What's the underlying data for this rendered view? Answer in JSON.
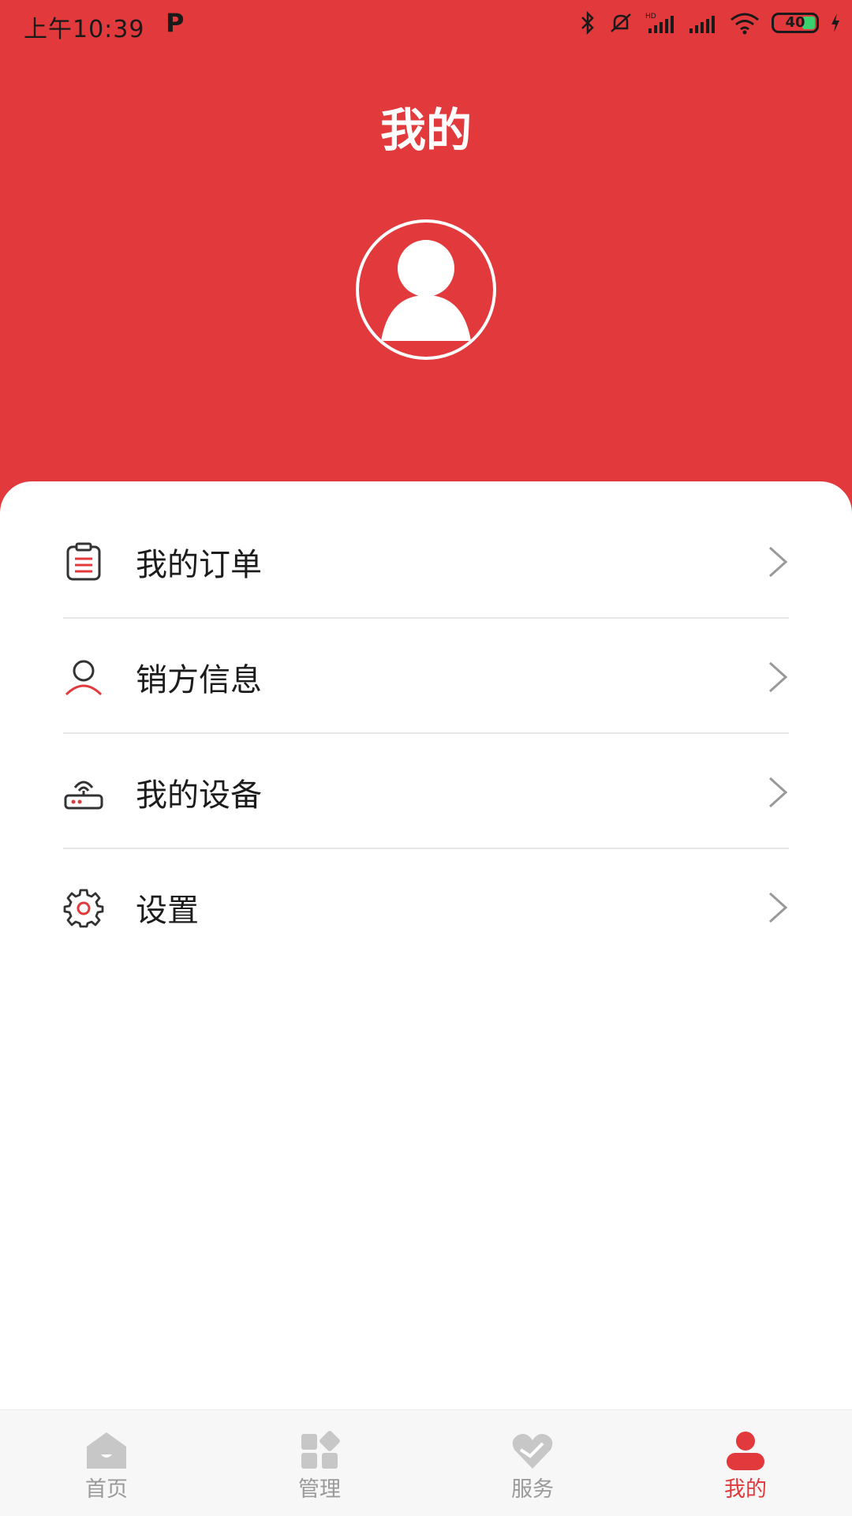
{
  "status_bar": {
    "time": "上午10:39",
    "notification_icon": "P",
    "battery_level": "40"
  },
  "header": {
    "title": "我的",
    "background_color": "#E2393C"
  },
  "menu": {
    "items": [
      {
        "label": "我的订单",
        "icon": "order-list-icon"
      },
      {
        "label": "销方信息",
        "icon": "user-icon"
      },
      {
        "label": "我的设备",
        "icon": "router-icon"
      },
      {
        "label": "设置",
        "icon": "gear-icon"
      }
    ]
  },
  "tab_bar": {
    "active_color": "#E2393C",
    "inactive_color": "#9a9a9a",
    "tabs": [
      {
        "label": "首页",
        "icon": "home-icon",
        "active": false
      },
      {
        "label": "管理",
        "icon": "grid-icon",
        "active": false
      },
      {
        "label": "服务",
        "icon": "heart-icon",
        "active": false
      },
      {
        "label": "我的",
        "icon": "profile-icon",
        "active": true
      }
    ]
  }
}
